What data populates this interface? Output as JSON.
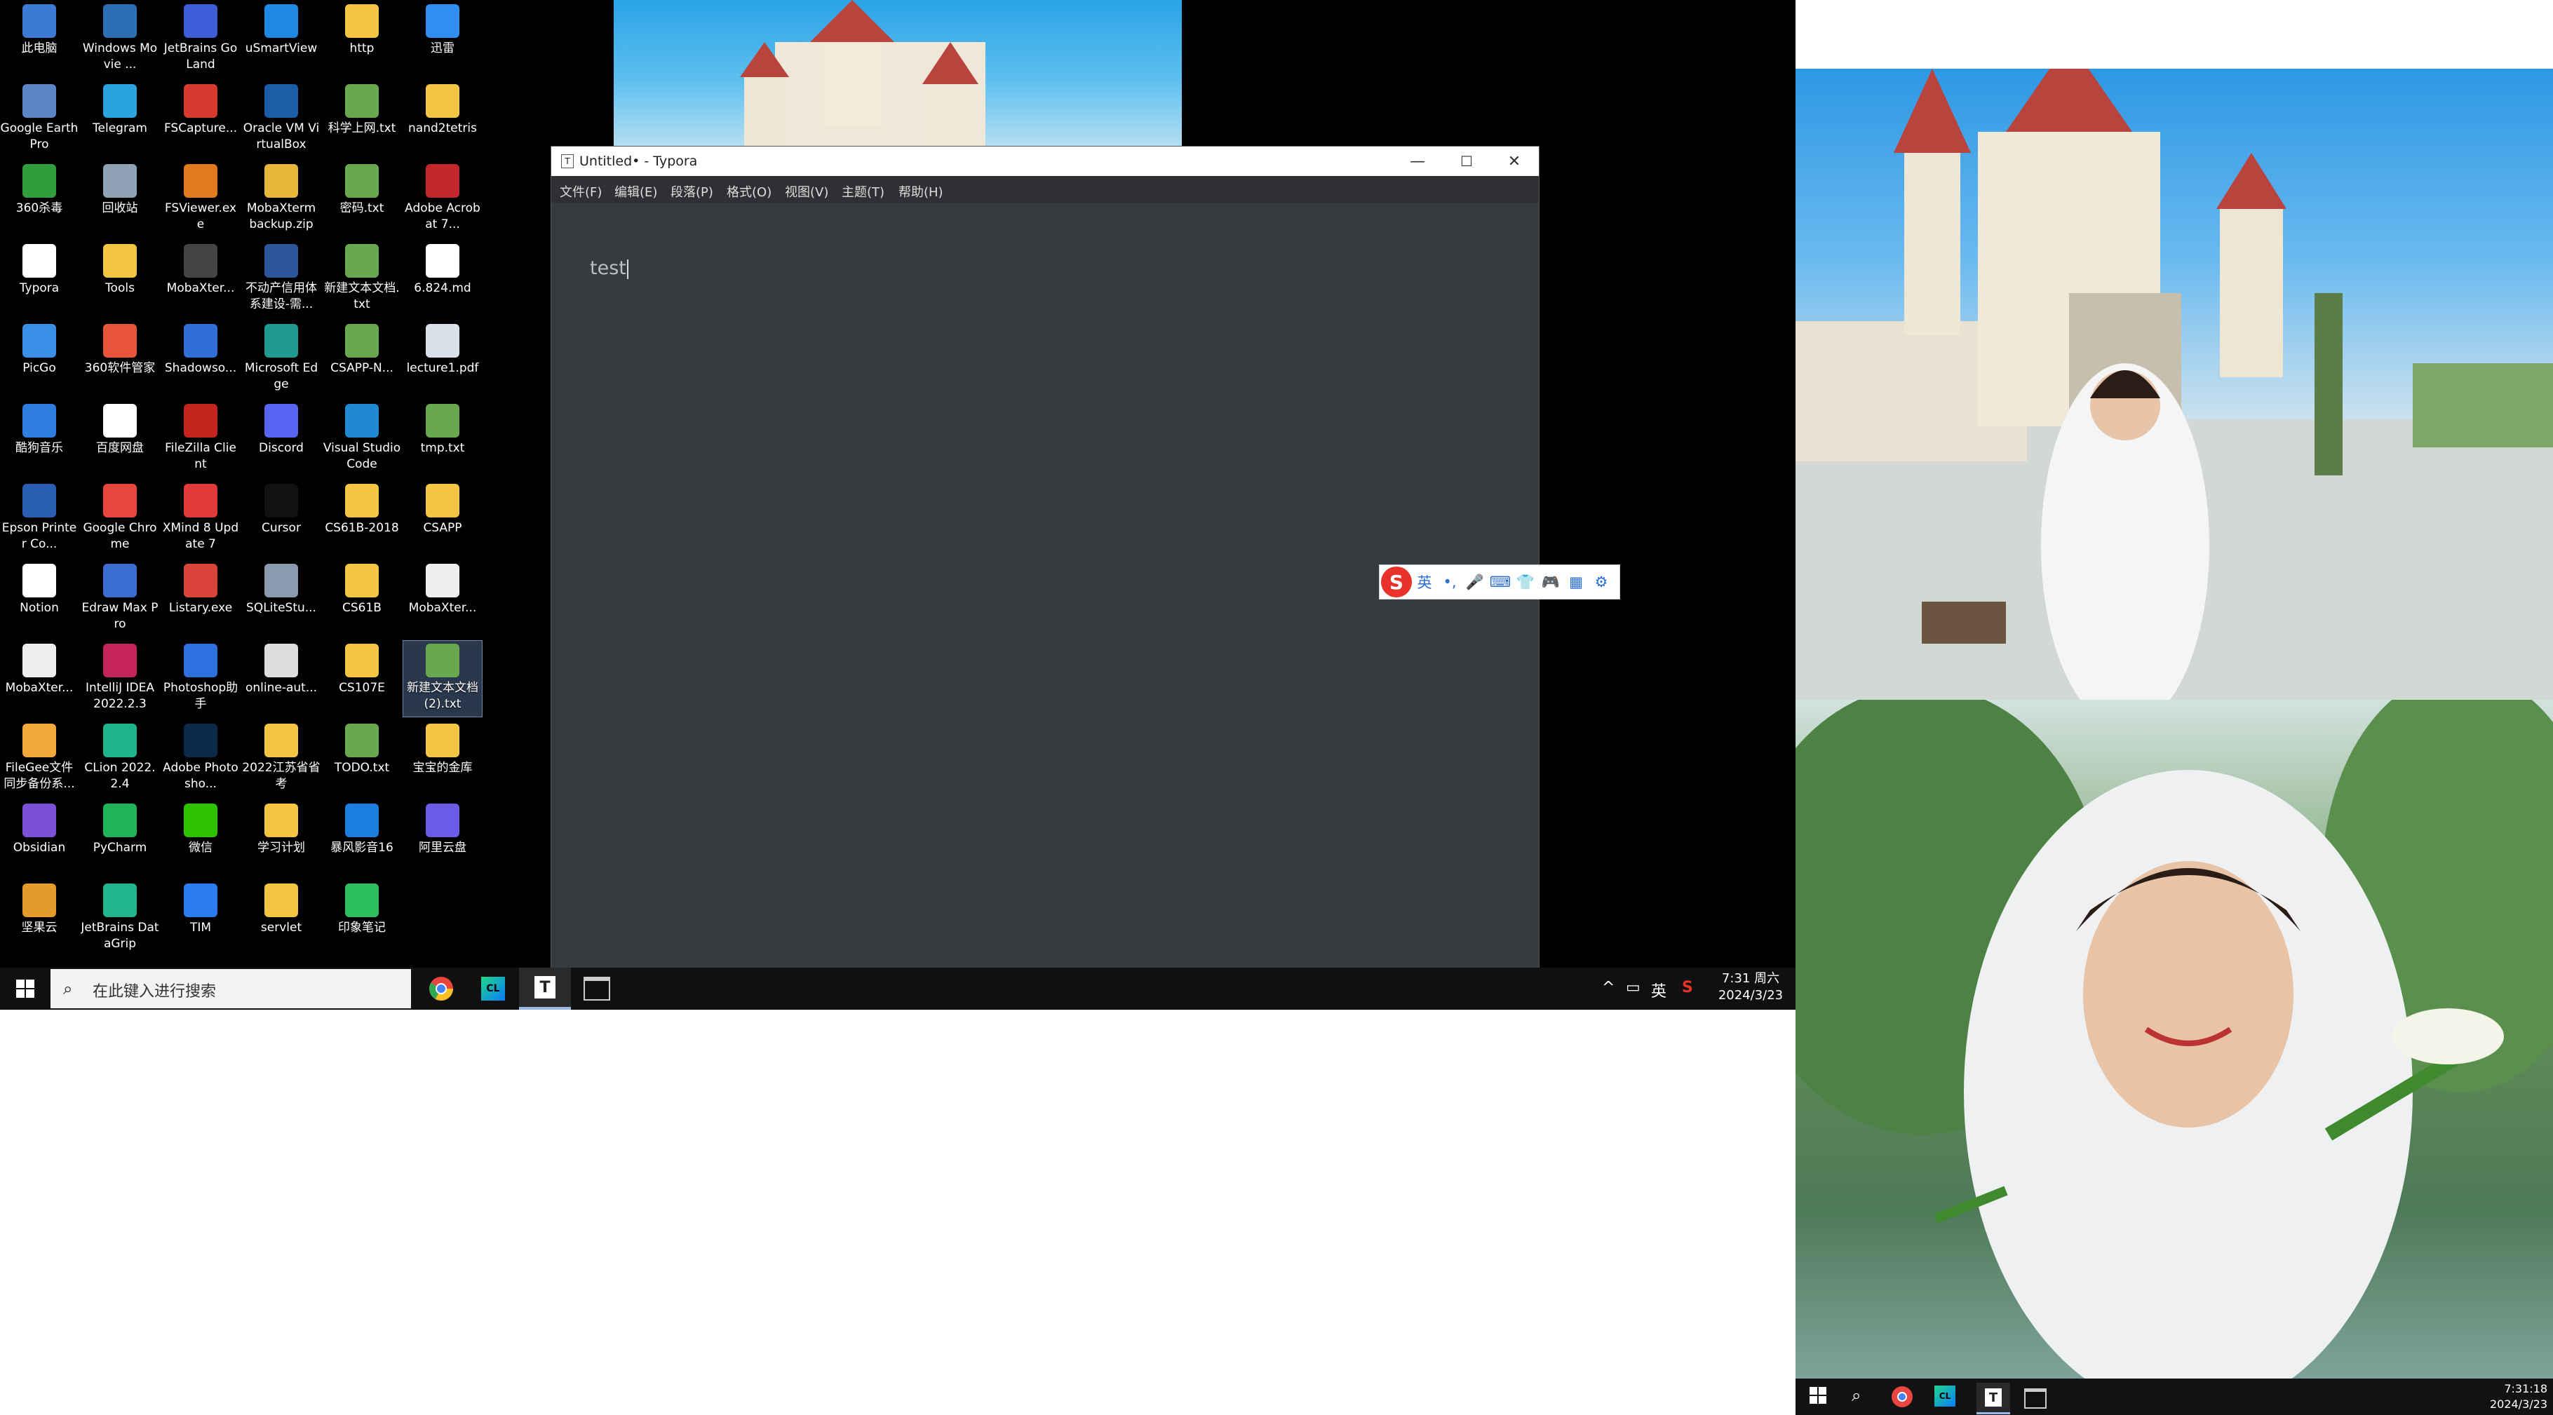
{
  "desktop": {
    "icons": [
      {
        "label": "此电脑",
        "icon": "computer-icon",
        "color": "#3b7bd6"
      },
      {
        "label": "Windows Movie ...",
        "icon": "movie-maker-icon",
        "color": "#2d6fb5"
      },
      {
        "label": "JetBrains GoLand",
        "icon": "goland-icon",
        "color": "#3e5bd8"
      },
      {
        "label": "uSmartView",
        "icon": "usmartview-icon",
        "color": "#1e88e5"
      },
      {
        "label": "http",
        "icon": "folder-icon",
        "color": "#f4c542"
      },
      {
        "label": "迅雷",
        "icon": "thunder-icon",
        "color": "#2f8ef0"
      },
      {
        "label": "Google Earth Pro",
        "icon": "google-earth-icon",
        "color": "#5a86c8"
      },
      {
        "label": "Telegram",
        "icon": "telegram-icon",
        "color": "#2aa3df"
      },
      {
        "label": "FSCapture...",
        "icon": "fscapture-icon",
        "color": "#d63a2f"
      },
      {
        "label": "Oracle VM VirtualBox",
        "icon": "virtualbox-icon",
        "color": "#1c5da8"
      },
      {
        "label": "科学上网.txt",
        "icon": "text-file-icon",
        "color": "#6aa84f"
      },
      {
        "label": "nand2tetris",
        "icon": "folder-icon",
        "color": "#f4c542"
      },
      {
        "label": "360杀毒",
        "icon": "antivirus-icon",
        "color": "#2f9e3b"
      },
      {
        "label": "回收站",
        "icon": "recycle-bin-icon",
        "color": "#8fa3b5"
      },
      {
        "label": "FSViewer.exe",
        "icon": "fsviewer-icon",
        "color": "#e07a1f"
      },
      {
        "label": "MobaXterm backup.zip",
        "icon": "zip-icon",
        "color": "#e6b73a"
      },
      {
        "label": "密码.txt",
        "icon": "text-file-icon",
        "color": "#6aa84f"
      },
      {
        "label": "Adobe Acrobat 7...",
        "icon": "pdf-icon",
        "color": "#c2272d"
      },
      {
        "label": "Typora",
        "icon": "typora-icon",
        "color": "#ffffff"
      },
      {
        "label": "Tools",
        "icon": "folder-icon",
        "color": "#f4c542"
      },
      {
        "label": "MobaXter...",
        "icon": "mobaxterm-icon",
        "color": "#444444"
      },
      {
        "label": "不动产信用体系建设-需...",
        "icon": "word-doc-icon",
        "color": "#2b579a"
      },
      {
        "label": "新建文本文档.txt",
        "icon": "text-file-icon",
        "color": "#6aa84f"
      },
      {
        "label": "6.824.md",
        "icon": "markdown-icon",
        "color": "#ffffff"
      },
      {
        "label": "PicGo",
        "icon": "picgo-icon",
        "color": "#3a8ee6"
      },
      {
        "label": "360软件管家",
        "icon": "software-manager-icon",
        "color": "#e8543a"
      },
      {
        "label": "Shadowso...",
        "icon": "shadowsocks-icon",
        "color": "#2f6fd6"
      },
      {
        "label": "Microsoft Edge",
        "icon": "edge-icon",
        "color": "#1f9a8f"
      },
      {
        "label": "CSAPP-N...",
        "icon": "text-file-icon",
        "color": "#6aa84f"
      },
      {
        "label": "lecture1.pdf",
        "icon": "pdf-file-icon",
        "color": "#d9e2ea"
      },
      {
        "label": "酷狗音乐",
        "icon": "kugou-icon",
        "color": "#2e7de0"
      },
      {
        "label": "百度网盘",
        "icon": "baidu-netdisk-icon",
        "color": "#ffffff"
      },
      {
        "label": "FileZilla Client",
        "icon": "filezilla-icon",
        "color": "#c4261e"
      },
      {
        "label": "Discord",
        "icon": "discord-icon",
        "color": "#5865f2"
      },
      {
        "label": "Visual Studio Code",
        "icon": "vscode-icon",
        "color": "#1f8ad2"
      },
      {
        "label": "tmp.txt",
        "icon": "text-file-icon",
        "color": "#6aa84f"
      },
      {
        "label": "Epson Printer Co...",
        "icon": "printer-icon",
        "color": "#2b5fb4"
      },
      {
        "label": "Google Chrome",
        "icon": "chrome-icon",
        "color": "#e8453c"
      },
      {
        "label": "XMind 8 Update 7",
        "icon": "xmind-icon",
        "color": "#e03a3a"
      },
      {
        "label": "Cursor",
        "icon": "cursor-app-icon",
        "color": "#111111"
      },
      {
        "label": "CS61B-2018",
        "icon": "folder-icon",
        "color": "#f4c542"
      },
      {
        "label": "CSAPP",
        "icon": "folder-icon",
        "color": "#f4c542"
      },
      {
        "label": "Notion",
        "icon": "notion-icon",
        "color": "#ffffff"
      },
      {
        "label": "Edraw Max Pro",
        "icon": "edraw-icon",
        "color": "#3b6cd1"
      },
      {
        "label": "Listary.exe",
        "icon": "listary-icon",
        "color": "#d9443a"
      },
      {
        "label": "SQLiteStu...",
        "icon": "sqlite-icon",
        "color": "#8a9bb0"
      },
      {
        "label": "CS61B",
        "icon": "folder-icon",
        "color": "#f4c542"
      },
      {
        "label": "MobaXter...",
        "icon": "file-icon",
        "color": "#eeeeee"
      },
      {
        "label": "MobaXter...",
        "icon": "file-icon",
        "color": "#eeeeee"
      },
      {
        "label": "IntelliJ IDEA 2022.2.3",
        "icon": "intellij-icon",
        "color": "#c3245c"
      },
      {
        "label": "Photoshop助手",
        "icon": "photoshop-helper-icon",
        "color": "#2f6fe0"
      },
      {
        "label": "online-aut...",
        "icon": "image-file-icon",
        "color": "#dddddd"
      },
      {
        "label": "CS107E",
        "icon": "folder-icon",
        "color": "#f4c542"
      },
      {
        "label": "新建文本文档 (2).txt",
        "icon": "text-file-icon",
        "color": "#6aa84f"
      },
      {
        "label": "FileGee文件同步备份系...",
        "icon": "filegee-icon",
        "color": "#f2a93b"
      },
      {
        "label": "CLion 2022.2.4",
        "icon": "clion-icon",
        "color": "#1fb58c"
      },
      {
        "label": "Adobe Photosho...",
        "icon": "photoshop-icon",
        "color": "#0b2a4a"
      },
      {
        "label": "2022江苏省省考",
        "icon": "folder-icon",
        "color": "#f4c542"
      },
      {
        "label": "TODO.txt",
        "icon": "text-file-icon",
        "color": "#6aa84f"
      },
      {
        "label": "宝宝的金库",
        "icon": "folder-icon",
        "color": "#f4c542"
      },
      {
        "label": "Obsidian",
        "icon": "obsidian-icon",
        "color": "#7b4fd6"
      },
      {
        "label": "PyCharm",
        "icon": "pycharm-icon",
        "color": "#21b35a"
      },
      {
        "label": "微信",
        "icon": "wechat-icon",
        "color": "#2dc100"
      },
      {
        "label": "学习计划",
        "icon": "folder-icon",
        "color": "#f4c542"
      },
      {
        "label": "暴风影音16",
        "icon": "storm-player-icon",
        "color": "#1c7fe0"
      },
      {
        "label": "阿里云盘",
        "icon": "aliyun-drive-icon",
        "color": "#6b5ce7"
      },
      {
        "label": "坚果云",
        "icon": "jianguoyun-icon",
        "color": "#e39b2c"
      },
      {
        "label": "JetBrains DataGrip",
        "icon": "datagrip-icon",
        "color": "#22b38f"
      },
      {
        "label": "TIM",
        "icon": "tim-icon",
        "color": "#2b7cf0"
      },
      {
        "label": "servlet",
        "icon": "folder-icon",
        "color": "#f4c542"
      },
      {
        "label": "印象笔记",
        "icon": "evernote-icon",
        "color": "#2dbe60"
      }
    ]
  },
  "typora": {
    "title": "Untitled• - Typora",
    "app_icon": "T",
    "menu": [
      "文件(F)",
      "编辑(E)",
      "段落(P)",
      "格式(O)",
      "视图(V)",
      "主题(T)",
      "帮助(H)"
    ],
    "content": "test",
    "controls": {
      "minimize": "—",
      "maximize": "☐",
      "close": "✕"
    }
  },
  "ime": {
    "logo": "S",
    "items": [
      "英",
      "•,",
      "🎤",
      "⌨",
      "👕",
      "🎮",
      "▦",
      "⚙"
    ]
  },
  "taskbar_left": {
    "search_placeholder": "在此键入进行搜索",
    "apps": [
      "chrome-icon",
      "clion-icon",
      "typora-icon",
      "terminal-icon"
    ],
    "tray_language": "英",
    "time": "7:31 周六",
    "date": "2024/3/23"
  },
  "taskbar_right": {
    "time": "7:31:18",
    "date": "2024/3/23"
  },
  "colors": {
    "desktop_bg": "#000000",
    "typora_editor_bg": "#363b40",
    "typora_menubar_bg": "#2e3033",
    "taskbar_bg": "#101010",
    "accent": "#9bb7e4"
  }
}
